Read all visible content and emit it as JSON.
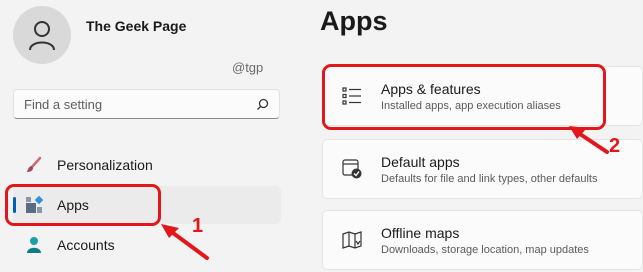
{
  "profile": {
    "name": "The Geek Page"
  },
  "watermark": "@tgp",
  "search": {
    "placeholder": "Find a setting",
    "icon": "search-icon"
  },
  "nav": {
    "items": [
      {
        "label": "Personalization",
        "icon": "paintbrush-icon"
      },
      {
        "label": "Apps",
        "icon": "apps-icon",
        "selected": true
      },
      {
        "label": "Accounts",
        "icon": "person-icon"
      }
    ]
  },
  "main": {
    "title": "Apps",
    "cards": [
      {
        "title": "Apps & features",
        "subtitle": "Installed apps, app execution aliases",
        "icon": "list-icon"
      },
      {
        "title": "Default apps",
        "subtitle": "Defaults for file and link types, other defaults",
        "icon": "default-app-icon"
      },
      {
        "title": "Offline maps",
        "subtitle": "Downloads, storage location, map updates",
        "icon": "map-icon"
      }
    ]
  },
  "annotations": {
    "step1": "1",
    "step2": "2",
    "color": "#e2161b"
  },
  "colors": {
    "accent": "#005fb8",
    "background": "#f3f3f3",
    "card": "#fbfbfb"
  }
}
